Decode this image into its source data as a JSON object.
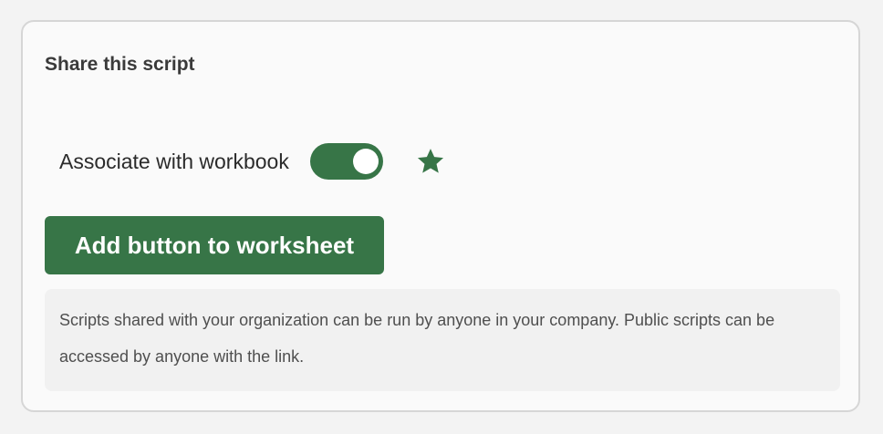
{
  "panel": {
    "title": "Share this script",
    "toggle": {
      "label": "Associate with workbook",
      "state": "on",
      "accent_color": "#377547"
    },
    "star": {
      "icon": "star-icon",
      "color": "#377547"
    },
    "primary_button": {
      "label": "Add button to worksheet",
      "color": "#377547"
    },
    "info": {
      "text": "Scripts shared with your organization can be run by anyone in your company. Public scripts can be accessed by anyone with the link."
    }
  }
}
